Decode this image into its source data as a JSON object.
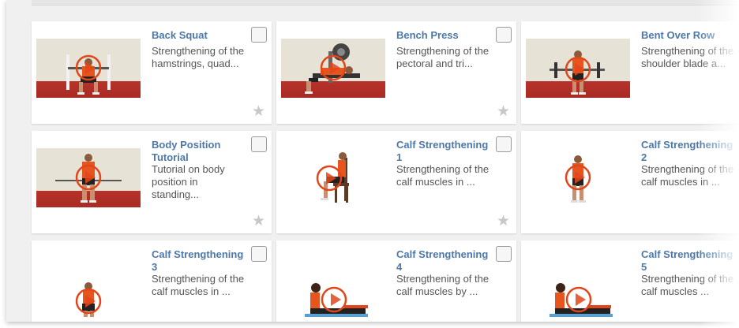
{
  "exercises": [
    {
      "title": "Back Squat",
      "desc": "Strengthening of the hamstrings, quad...",
      "has_star": true
    },
    {
      "title": "Bench Press",
      "desc": "Strengthening of the pectoral and tri...",
      "has_star": true
    },
    {
      "title": "Bent Over Row",
      "desc": "Strengthening of the shoulder blade a...",
      "has_star": false
    },
    {
      "title": "Body Position Tutorial",
      "desc": "Tutorial on body position in standing...",
      "has_star": true
    },
    {
      "title": "Calf Strengthening 1",
      "desc": "Strengthening of the calf muscles in ...",
      "has_star": true
    },
    {
      "title": "Calf Strengthening 2",
      "desc": "Strengthening of the calf muscles in ...",
      "has_star": false
    },
    {
      "title": "Calf Strengthening 3",
      "desc": "Strengthening of the calf muscles in ...",
      "has_star": false
    },
    {
      "title": "Calf Strengthening 4",
      "desc": "Strengthening of the calf muscles by ...",
      "has_star": false
    },
    {
      "title": "Calf Strengthening 5",
      "desc": "Strengthening of the calf muscles ...",
      "has_star": false
    }
  ],
  "icons": {
    "favorite": "star-icon",
    "play": "play-icon",
    "select": "checkbox"
  },
  "colors": {
    "title": "#4d78a8",
    "play_ring": "#e0461a",
    "accent_shirt": "#e8541e"
  }
}
